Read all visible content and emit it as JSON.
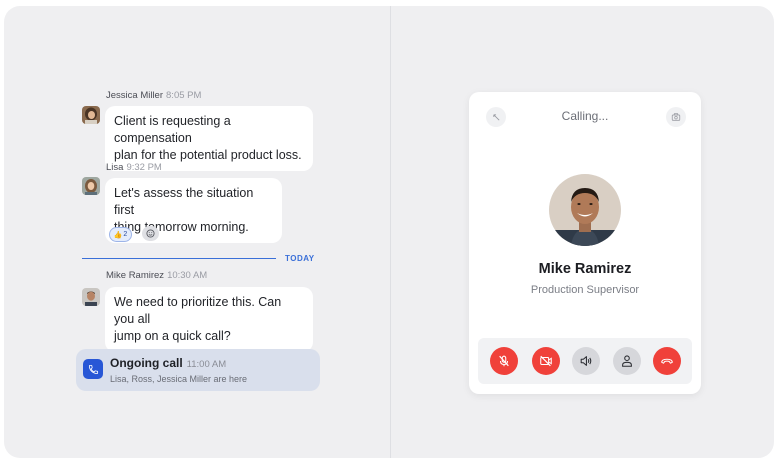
{
  "chat": {
    "messages": [
      {
        "sender": "Jessica Miller",
        "time": "8:05 PM",
        "lines": [
          "Client is requesting a compensation",
          "plan for the potential product loss."
        ]
      },
      {
        "sender": "Lisa",
        "time": "9:32 PM",
        "lines": [
          "Let's assess the situation first",
          "thing tomorrow morning."
        ],
        "reaction": {
          "emoji": "👍",
          "count": "2"
        }
      },
      {
        "sender": "Mike Ramirez",
        "time": "10:30 AM",
        "lines": [
          "We need to prioritize this. Can you all",
          "jump on a quick call?"
        ]
      }
    ],
    "divider_label": "TODAY",
    "ongoing_call": {
      "title": "Ongoing call",
      "time": "11:00 AM",
      "participants": "Lisa, Ross, Jessica Miller are here"
    }
  },
  "call": {
    "status": "Calling...",
    "caller_name": "Mike Ramirez",
    "caller_role": "Production Supervisor"
  },
  "colors": {
    "accent": "#3a6fd8",
    "danger": "#f0413a",
    "call_badge": "#2857d6"
  }
}
